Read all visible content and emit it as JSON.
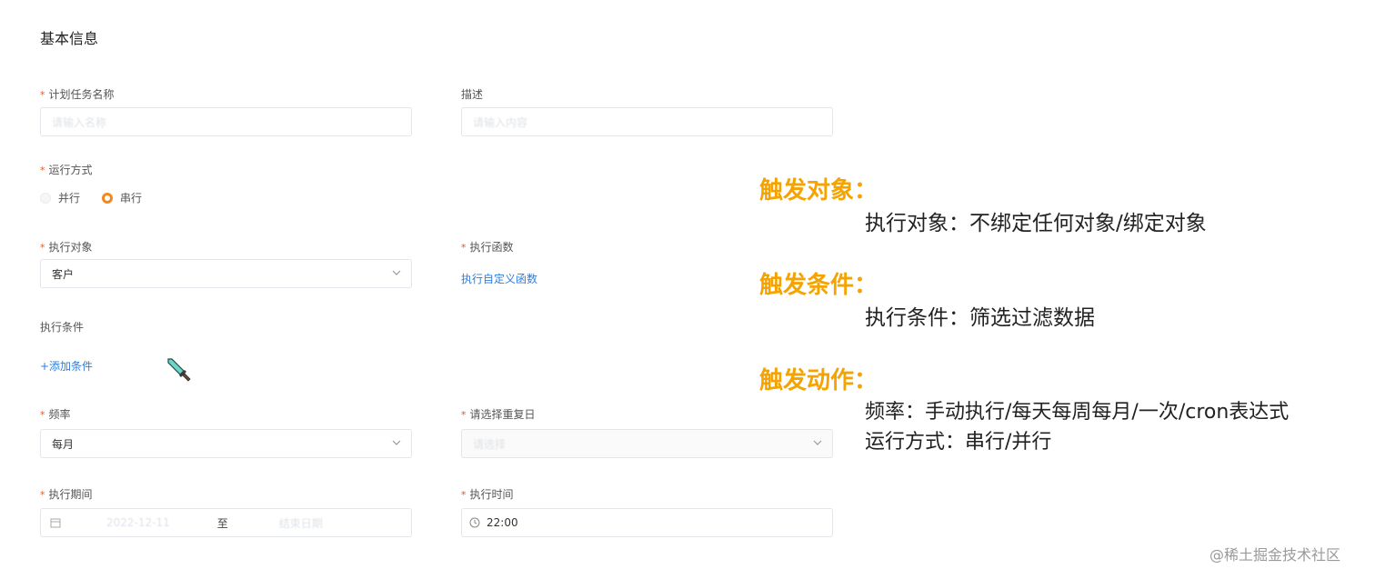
{
  "section": {
    "title": "基本信息"
  },
  "form": {
    "task_name": {
      "label": "计划任务名称",
      "placeholder": "请输入名称"
    },
    "description": {
      "label": "描述",
      "placeholder": "请输入内容"
    },
    "run_mode": {
      "label": "运行方式",
      "options": [
        "并行",
        "串行"
      ],
      "selected": "串行"
    },
    "target": {
      "label": "执行对象",
      "value": "客户"
    },
    "function": {
      "label": "执行函数",
      "link": "执行自定义函数"
    },
    "condition": {
      "label": "执行条件",
      "add_link": "+添加条件"
    },
    "frequency": {
      "label": "频率",
      "value": "每月"
    },
    "repeat_day": {
      "label": "请选择重复日",
      "placeholder": "请选择"
    },
    "period": {
      "label": "执行期间",
      "start_placeholder": "2022-12-11",
      "separator": "至",
      "end_placeholder": "结束日期"
    },
    "time": {
      "label": "执行时间",
      "value": "22:00"
    }
  },
  "annotations": {
    "trigger_object": {
      "heading": "触发对象：",
      "text": "执行对象：不绑定任何对象/绑定对象"
    },
    "trigger_condition": {
      "heading": "触发条件：",
      "text": "执行条件：筛选过滤数据"
    },
    "trigger_action": {
      "heading": "触发动作：",
      "lines": [
        "频率：手动执行/每天每周每月/一次/cron表达式",
        "运行方式：串行/并行"
      ]
    }
  },
  "watermark": "@稀土掘金技术社区",
  "colors": {
    "accent_orange": "#f5a300",
    "link_blue": "#2f7de1",
    "radio_orange": "#f08a1c",
    "required_mark": "#e05a2b"
  },
  "icons": [
    "chevron-down-icon",
    "calendar-icon",
    "clock-icon",
    "sword-cursor-icon"
  ]
}
